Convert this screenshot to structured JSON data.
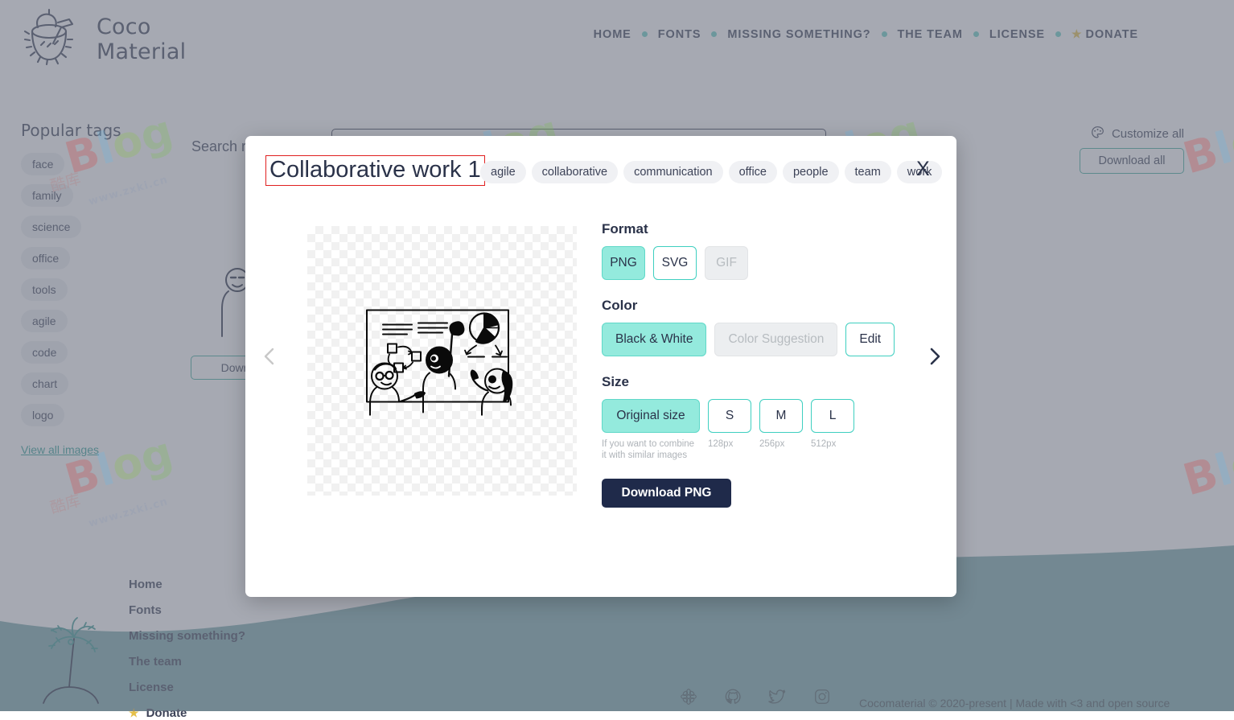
{
  "site": {
    "logo_line1": "Coco",
    "logo_line2": "Material",
    "logo_icon": "coconut-drink-icon"
  },
  "nav": {
    "items": [
      {
        "label": "HOME"
      },
      {
        "label": "FONTS"
      },
      {
        "label": "MISSING SOMETHING?"
      },
      {
        "label": "THE TEAM"
      },
      {
        "label": "LICENSE"
      },
      {
        "label": "DONATE",
        "icon": "star-icon"
      }
    ]
  },
  "sidebar": {
    "title": "Popular tags",
    "tags": [
      "face",
      "family",
      "science",
      "office",
      "tools",
      "agile",
      "code",
      "chart",
      "logo"
    ],
    "view_all": "View all images"
  },
  "search": {
    "label": "Search r",
    "value": "",
    "placeholder": ""
  },
  "actions": {
    "customize_all": "Customize all",
    "customize_icon": "palette-icon",
    "download_all": "Download all"
  },
  "result_card": {
    "download_label": "Downlo"
  },
  "modal": {
    "title": "Collaborative work 1",
    "title_highlight_color": "#e02020",
    "tags": [
      "agile",
      "collaborative",
      "communication",
      "office",
      "people",
      "team",
      "work"
    ],
    "close_label": "X",
    "prev_icon": "chevron-left-icon",
    "next_icon": "chevron-right-icon",
    "preview_alt": "collaborative-work-illustration",
    "format": {
      "heading": "Format",
      "options": [
        {
          "label": "PNG",
          "state": "selected"
        },
        {
          "label": "SVG",
          "state": "normal"
        },
        {
          "label": "GIF",
          "state": "disabled"
        }
      ]
    },
    "color": {
      "heading": "Color",
      "options": [
        {
          "label": "Black & White",
          "state": "selected"
        },
        {
          "label": "Color Suggestion",
          "state": "disabled"
        },
        {
          "label": "Edit",
          "state": "normal"
        }
      ]
    },
    "size": {
      "heading": "Size",
      "options": [
        {
          "label": "Original size",
          "state": "selected",
          "note": "If you want to combine it with similar images"
        },
        {
          "label": "S",
          "state": "normal",
          "note": "128px"
        },
        {
          "label": "M",
          "state": "normal",
          "note": "256px"
        },
        {
          "label": "L",
          "state": "normal",
          "note": "512px"
        }
      ]
    },
    "download_button": "Download PNG"
  },
  "footer": {
    "links": [
      "Home",
      "Fonts",
      "Missing something?",
      "The team",
      "License"
    ],
    "donate": "Donate",
    "donate_icon": "star-icon",
    "social": [
      "flower-icon",
      "github-icon",
      "twitter-icon",
      "instagram-icon"
    ],
    "copyright": "Cocomaterial © 2020-present | Made with <3 and open source"
  },
  "colors": {
    "accent_teal": "#3ecfc0",
    "accent_teal_fill": "#94eadd",
    "dark_navy": "#1f2a4a",
    "wave_teal": "#7aa9ab",
    "text": "#3c4257"
  },
  "watermark": {
    "big": "Blog",
    "small": "www.zxki.cn",
    "cn": "酷库"
  }
}
